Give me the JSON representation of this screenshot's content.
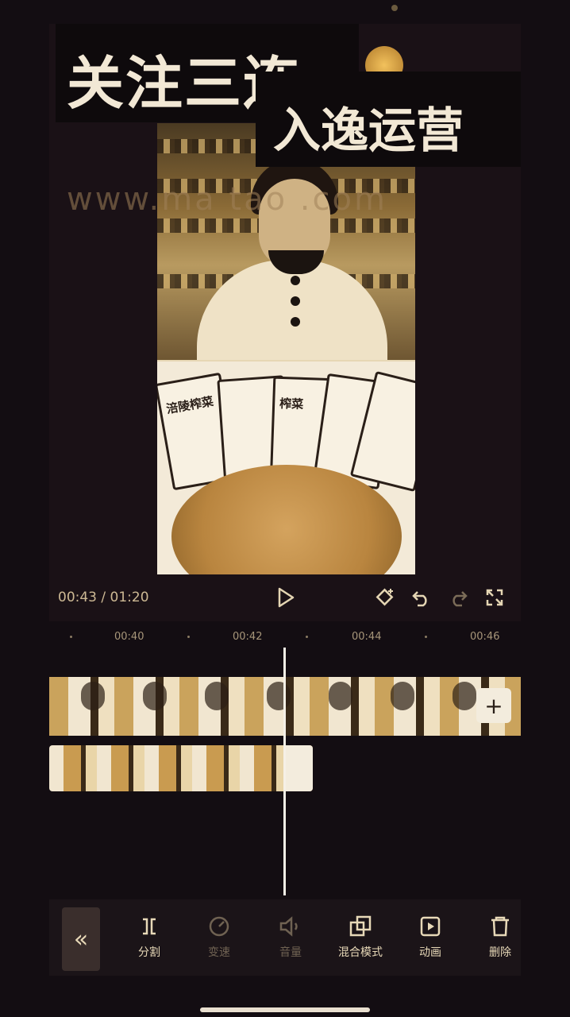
{
  "overlay": {
    "title_line1": "关注三连",
    "title_line2": "入逸运营",
    "watermark": "www.ma  tao .com"
  },
  "product": {
    "label": "涪陵榨菜",
    "label_short": "榨菜"
  },
  "player": {
    "current_time": "00:43",
    "separator": " / ",
    "total_time": "01:20",
    "icons": [
      "play-icon",
      "keyframe-icon",
      "undo-icon",
      "redo-icon",
      "fullscreen-icon"
    ]
  },
  "ruler": {
    "ticks": [
      "00:40",
      "00:42",
      "00:44",
      "00:46"
    ]
  },
  "timeline": {
    "add_label": "+"
  },
  "toolbar": {
    "back_label": "«",
    "items": [
      {
        "label": "分割",
        "icon": "split-icon",
        "enabled": true
      },
      {
        "label": "变速",
        "icon": "speed-icon",
        "enabled": false
      },
      {
        "label": "音量",
        "icon": "volume-icon",
        "enabled": false
      },
      {
        "label": "混合模式",
        "icon": "blend-mode-icon",
        "enabled": true
      },
      {
        "label": "动画",
        "icon": "animation-icon",
        "enabled": true
      },
      {
        "label": "删除",
        "icon": "delete-icon",
        "enabled": true
      }
    ]
  }
}
